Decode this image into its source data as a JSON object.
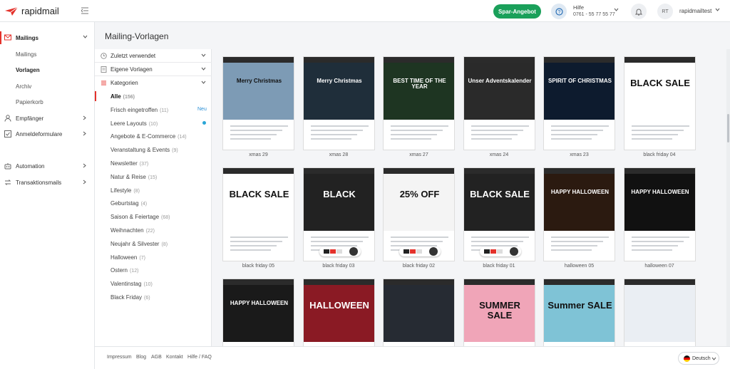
{
  "app": {
    "logo_text": "rapidmail"
  },
  "header": {
    "offer_button": "Spar-Angebot",
    "help_title": "Hilfe",
    "help_phone": "0761 - 55 77 55 77",
    "avatar_initials": "RT",
    "user_name": "rapidmailtest"
  },
  "sidebar": {
    "mailings_label": "Mailings",
    "sub_items": [
      {
        "label": "Mailings"
      },
      {
        "label": "Vorlagen"
      },
      {
        "label": "Archiv"
      },
      {
        "label": "Papierkorb"
      }
    ],
    "empfaenger_label": "Empfänger",
    "anmelde_label": "Anmeldeformulare",
    "automation_label": "Automation",
    "transaktion_label": "Transaktionsmails"
  },
  "page": {
    "title": "Mailing-Vorlagen"
  },
  "filters": {
    "recent_label": "Zuletzt verwendet",
    "own_label": "Eigene Vorlagen",
    "categories_label": "Kategorien",
    "new_badge": "Neu",
    "categories": [
      {
        "label": "Alle",
        "count": "(156)"
      },
      {
        "label": "Frisch eingetroffen",
        "count": "(11)"
      },
      {
        "label": "Leere Layouts",
        "count": "(10)"
      },
      {
        "label": "Angebote & E-Commerce",
        "count": "(14)"
      },
      {
        "label": "Veranstaltung & Events",
        "count": "(9)"
      },
      {
        "label": "Newsletter",
        "count": "(37)"
      },
      {
        "label": "Natur & Reise",
        "count": "(15)"
      },
      {
        "label": "Lifestyle",
        "count": "(8)"
      },
      {
        "label": "Geburtstag",
        "count": "(4)"
      },
      {
        "label": "Saison & Feiertage",
        "count": "(68)"
      },
      {
        "label": "Weihnachten",
        "count": "(22)"
      },
      {
        "label": "Neujahr & Silvester",
        "count": "(8)"
      },
      {
        "label": "Halloween",
        "count": "(7)"
      },
      {
        "label": "Ostern",
        "count": "(12)"
      },
      {
        "label": "Valentinstag",
        "count": "(10)"
      },
      {
        "label": "Black Friday",
        "count": "(6)"
      }
    ]
  },
  "templates": [
    {
      "name": "xmas 29",
      "headline": "Merry Christmas",
      "color": "#7d9bb5"
    },
    {
      "name": "xmas 28",
      "headline": "Merry Christmas",
      "color": "#1f2e3a"
    },
    {
      "name": "xmas 27",
      "headline": "BEST TIME OF THE YEAR",
      "color": "#1e3522"
    },
    {
      "name": "xmas 24",
      "headline": "Unser Adventskalender",
      "color": "#2a2a2a"
    },
    {
      "name": "xmas 23",
      "headline": "SPIRIT OF CHRISTMAS",
      "color": "#0d1b2e"
    },
    {
      "name": "black friday 04",
      "headline": "BLACK SALE",
      "color": "#ffffff"
    },
    {
      "name": "black friday 05",
      "headline": "BLACK SALE",
      "color": "#ffffff"
    },
    {
      "name": "black friday 03",
      "headline": "BLACK",
      "color": "#222222"
    },
    {
      "name": "black friday 02",
      "headline": "25% OFF",
      "color": "#f4f4f4"
    },
    {
      "name": "black friday 01",
      "headline": "BLACK SALE",
      "color": "#222222"
    },
    {
      "name": "halloween 05",
      "headline": "HAPPY HALLOWEEN",
      "color": "#2b1a10"
    },
    {
      "name": "halloween 07",
      "headline": "HAPPY HALLOWEEN",
      "color": "#111111"
    },
    {
      "name": "",
      "headline": "HAPPY HALLOWEEN",
      "color": "#1a1a1a"
    },
    {
      "name": "",
      "headline": "HALLOWEEN",
      "color": "#8a1a24"
    },
    {
      "name": "",
      "headline": "",
      "color": "#262b33"
    },
    {
      "name": "",
      "headline": "SUMMER SALE",
      "color": "#f0a5b8"
    },
    {
      "name": "",
      "headline": "Summer SALE",
      "color": "#7fc3d6"
    },
    {
      "name": "",
      "headline": "",
      "color": "#eaeef3"
    }
  ],
  "footer": {
    "links": [
      {
        "label": "Impressum"
      },
      {
        "label": "Blog"
      },
      {
        "label": "AGB"
      },
      {
        "label": "Kontakt"
      },
      {
        "label": "Hilfe / FAQ"
      }
    ],
    "language": "Deutsch"
  },
  "colors": {
    "accent": "#e4322b",
    "offer_green": "#1aa05a",
    "link_blue": "#2a8fd6"
  },
  "icons": [
    "rapidmail-logo-icon",
    "collapse-menu-icon",
    "help-icon",
    "bell-icon",
    "chevron-down-icon",
    "mail-icon",
    "user-icon",
    "form-icon",
    "automation-icon",
    "transaction-icon",
    "clock-icon",
    "document-icon",
    "list-icon",
    "germany-flag-icon"
  ]
}
